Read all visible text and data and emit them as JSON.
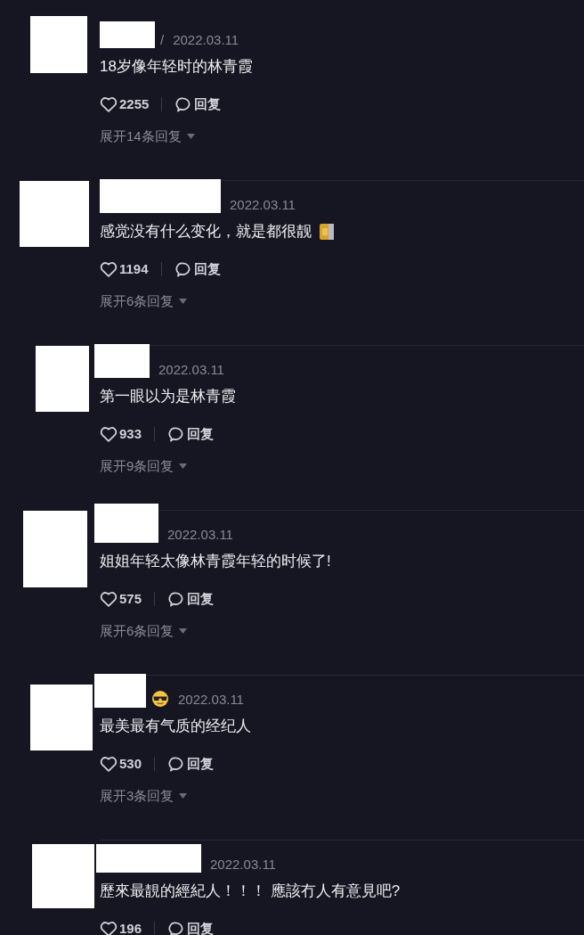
{
  "comments": [
    {
      "name_fragment": "/",
      "date": "2022.03.11",
      "text": "18岁像年轻时的林青霞",
      "likes": "2255",
      "reply": "回复",
      "expand": "展开14条回复"
    },
    {
      "date": "2022.03.11",
      "text": "感觉没有什么变化，就是都很靓",
      "text_icon": {
        "kind": "sticker"
      },
      "likes": "1194",
      "reply": "回复",
      "expand": "展开6条回复"
    },
    {
      "date": "2022.03.11",
      "text": "第一眼以为是林青霞",
      "likes": "933",
      "reply": "回复",
      "expand": "展开9条回复"
    },
    {
      "date": "2022.03.11",
      "text": "姐姐年轻太像林青霞年轻的时候了!",
      "likes": "575",
      "reply": "回复",
      "expand": "展开6条回复"
    },
    {
      "name_icon": {
        "kind": "sunglasses"
      },
      "date": "2022.03.11",
      "text": "最美最有气质的经纪人",
      "likes": "530",
      "reply": "回复",
      "expand": "展开3条回复"
    },
    {
      "date": "2022.03.11",
      "text": "歷來最靚的經紀人！！！ 應該冇人有意見吧?",
      "likes": "196",
      "reply": "回复"
    }
  ]
}
